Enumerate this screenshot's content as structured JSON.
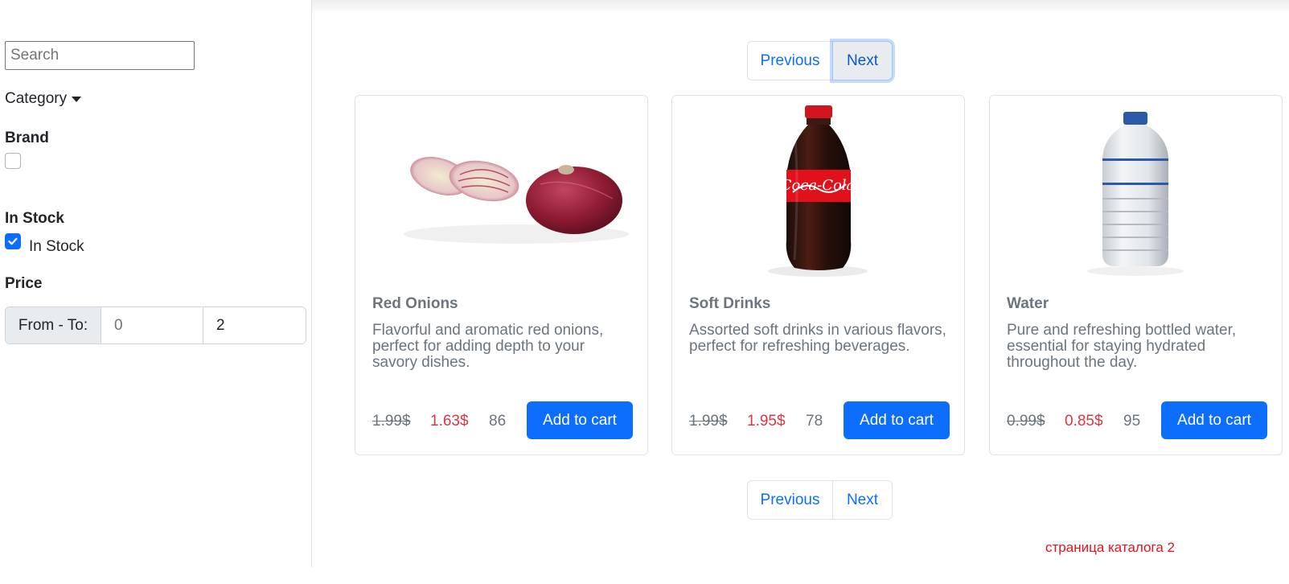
{
  "sidebar": {
    "search_placeholder": "Search",
    "category_label": "Category",
    "brand_heading": "Brand",
    "brand_checked": false,
    "in_stock_heading": "In Stock",
    "in_stock_label": "In Stock",
    "in_stock_checked": true,
    "price_heading": "Price",
    "price_range_label": "From - To:",
    "price_from_placeholder": "0",
    "price_to_value": "2"
  },
  "pagination": {
    "previous_label": "Previous",
    "next_label": "Next"
  },
  "products": [
    {
      "name": "Red Onions",
      "description": "Flavorful and aromatic red onions, perfect for adding depth to your savory dishes.",
      "old_price": "1.99$",
      "price": "1.63$",
      "stock": "86",
      "button_label": "Add to cart",
      "image_icon": "red-onion-image"
    },
    {
      "name": "Soft Drinks",
      "description": "Assorted soft drinks in various flavors, perfect for refreshing beverages.",
      "old_price": "1.99$",
      "price": "1.95$",
      "stock": "78",
      "button_label": "Add to cart",
      "image_icon": "cola-bottle-image"
    },
    {
      "name": "Water",
      "description": "Pure and refreshing bottled water, essential for staying hydrated throughout the day.",
      "old_price": "0.99$",
      "price": "0.85$",
      "stock": "95",
      "button_label": "Add to cart",
      "image_icon": "water-bottle-image"
    }
  ],
  "footer_note": "страница каталога 2",
  "colors": {
    "primary": "#0d6efd",
    "sale_price": "#dc3545",
    "muted_text": "#6c757d",
    "note_text": "#e8121c"
  }
}
